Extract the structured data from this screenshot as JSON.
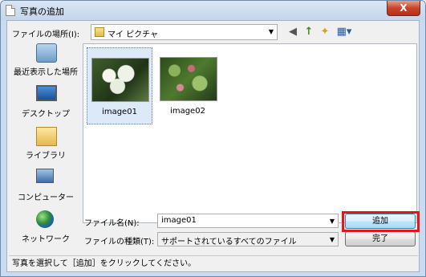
{
  "window": {
    "title": "写真の追加",
    "close_glyph": "X"
  },
  "lookin": {
    "label": "ファイルの場所(I):",
    "value": "マイ ピクチャ"
  },
  "toolbar": {
    "back": "◀",
    "up": "↑",
    "newfolder": "✦",
    "views": "▦▾"
  },
  "places": [
    {
      "label": "最近表示した場所"
    },
    {
      "label": "デスクトップ"
    },
    {
      "label": "ライブラリ"
    },
    {
      "label": "コンピューター"
    },
    {
      "label": "ネットワーク"
    }
  ],
  "files": [
    {
      "name": "image01"
    },
    {
      "name": "image02"
    }
  ],
  "filename": {
    "label": "ファイル名(N):",
    "value": "image01"
  },
  "filetype": {
    "label": "ファイルの種類(T):",
    "value": "サポートされているすべてのファイル"
  },
  "buttons": {
    "add": "追加",
    "done": "完了"
  },
  "status": "写真を選択して［追加］をクリックしてください。",
  "colors": {
    "highlight": "#e8141c",
    "accent": "#3c7fb1"
  }
}
